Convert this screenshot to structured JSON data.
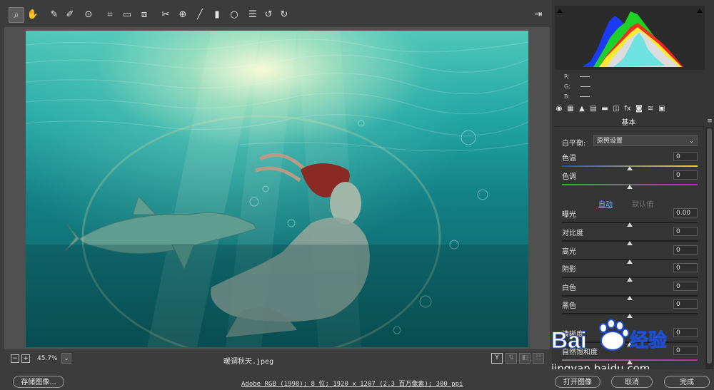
{
  "toolbar": {
    "tools": [
      {
        "name": "zoom-tool-icon",
        "glyph": "⌕"
      },
      {
        "name": "hand-tool-icon",
        "glyph": "✋"
      },
      {
        "name": "white-balance-tool-icon",
        "glyph": "✎"
      },
      {
        "name": "color-sampler-tool-icon",
        "glyph": "✐"
      },
      {
        "name": "targeted-adjustment-tool-icon",
        "glyph": "⊙"
      },
      {
        "name": "crop-tool-icon",
        "glyph": "⌗"
      },
      {
        "name": "straighten-tool-icon",
        "glyph": "▭"
      },
      {
        "name": "transform-tool-icon",
        "glyph": "⧈"
      },
      {
        "name": "spot-removal-tool-icon",
        "glyph": "✂"
      },
      {
        "name": "red-eye-tool-icon",
        "glyph": "⊕"
      },
      {
        "name": "adjustment-brush-icon",
        "glyph": "╱"
      },
      {
        "name": "graduated-filter-icon",
        "glyph": "▮"
      },
      {
        "name": "radial-filter-icon",
        "glyph": "○"
      },
      {
        "name": "preferences-icon",
        "glyph": "☰"
      },
      {
        "name": "rotate-left-icon",
        "glyph": "↺"
      },
      {
        "name": "rotate-right-icon",
        "glyph": "↻"
      },
      {
        "name": "open-photoshop-icon",
        "glyph": "⇥"
      }
    ]
  },
  "canvas": {
    "zoom_minus": "−",
    "zoom_plus": "+",
    "zoom_value": "45.7%",
    "zoom_dropdown": "⌄",
    "filename": "暖调秋天.jpeg",
    "view_buttons": [
      "Y",
      "⇅",
      "◧",
      "☷"
    ]
  },
  "histogram": {
    "r_label": "R:",
    "g_label": "G:",
    "b_label": "B:"
  },
  "panel_tabs": [
    "◉",
    "▦",
    "▲",
    "▤",
    "▬",
    "◫",
    "fx",
    "◙",
    "≋",
    "▣"
  ],
  "panel": {
    "section_title": "基本",
    "white_balance_label": "白平衡:",
    "white_balance_value": "原照设置",
    "auto_label": "自动",
    "default_label": "默认值",
    "sliders": [
      {
        "label": "色温",
        "value": "0",
        "position": 0.5
      },
      {
        "label": "色调",
        "value": "0",
        "position": 0.5
      },
      {
        "label": "曝光",
        "value": "0.00",
        "position": 0.5
      },
      {
        "label": "对比度",
        "value": "0",
        "position": 0.5
      },
      {
        "label": "高光",
        "value": "0",
        "position": 0.5
      },
      {
        "label": "阴影",
        "value": "0",
        "position": 0.5
      },
      {
        "label": "白色",
        "value": "0",
        "position": 0.5
      },
      {
        "label": "黑色",
        "value": "0",
        "position": 0.5
      },
      {
        "label": "清晰度",
        "value": "0",
        "position": 0.5
      },
      {
        "label": "自然饱和度",
        "value": "0",
        "position": 0.5
      }
    ]
  },
  "bottom": {
    "save_button": "存储图像...",
    "workflow": "Adobe RGB (1998); 8 位; 1920 x 1207 (2.3 百万像素); 300 ppi",
    "open_button": "打开图像",
    "cancel_button": "取消",
    "done_button": "完成"
  },
  "watermark": {
    "brand": "Bai",
    "brand_cn": "经验",
    "url": "jingyan.baidu.com"
  },
  "colors": {
    "accent_blue": "#3a6fd8",
    "water_top": "#4fc7b9",
    "water_bottom": "#0a5559"
  }
}
